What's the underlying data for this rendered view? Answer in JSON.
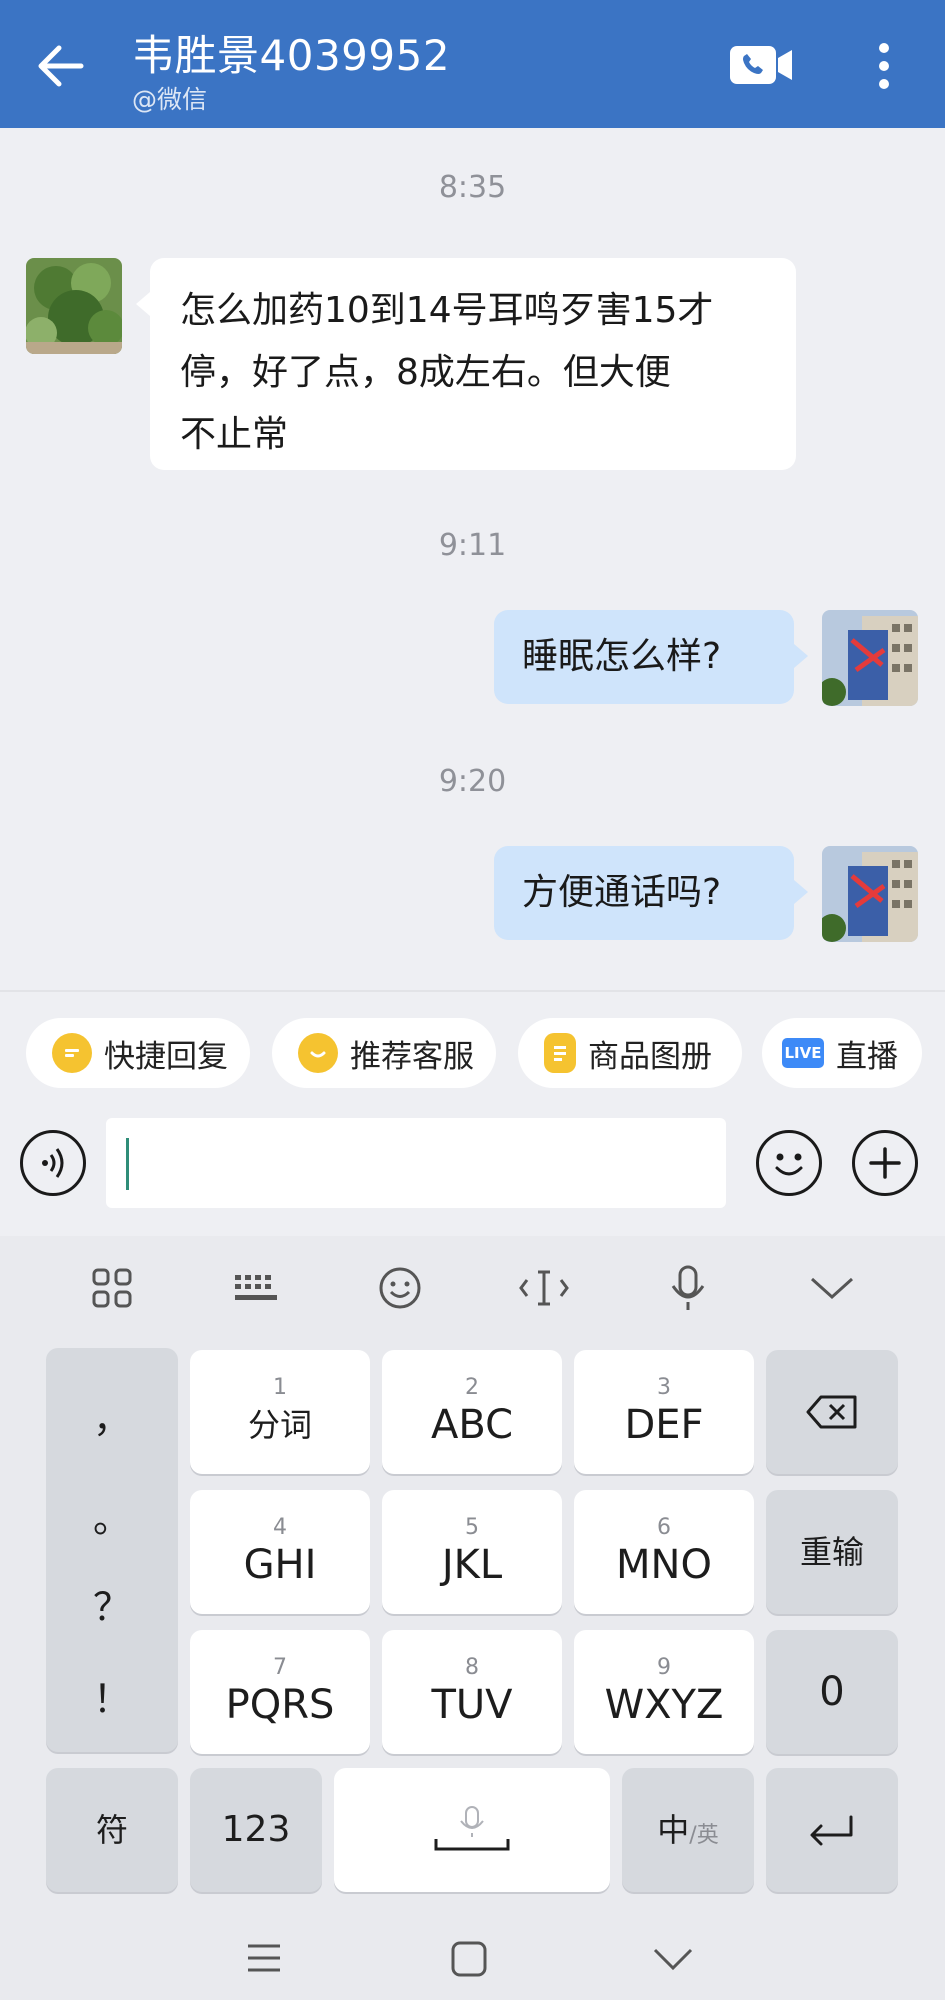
{
  "header": {
    "title": "韦胜景4039952",
    "subtitle": "@微信",
    "back_icon": "arrow-left-icon",
    "call_icon": "video-call-icon",
    "more_icon": "more-vertical-icon",
    "bg_color": "#3b74c4"
  },
  "messages": [
    {
      "time": "8:35",
      "from": "contact",
      "lines": [
        "怎么加药10到14号耳鸣歹害15才",
        "停，好了点，8成左右。但大便",
        "不止常"
      ]
    },
    {
      "time": "9:11",
      "from": "me",
      "lines": [
        "睡眠怎么样?"
      ]
    },
    {
      "time": "9:20",
      "from": "me",
      "lines": [
        "方便通话吗?"
      ]
    }
  ],
  "quick_actions": [
    {
      "label": "快捷回复",
      "icon": "quick-reply-icon"
    },
    {
      "label": "推荐客服",
      "icon": "recommend-service-icon"
    },
    {
      "label": "商品图册",
      "icon": "product-album-icon"
    },
    {
      "label": "直播",
      "icon": "live-icon",
      "badge": "LIVE"
    }
  ],
  "input": {
    "value": "",
    "placeholder": ""
  },
  "keyboard": {
    "toolbar": [
      "apps-grid-icon",
      "keyboard-icon",
      "emoji-icon",
      "cursor-icon",
      "microphone-icon",
      "collapse-icon"
    ],
    "punctuation": [
      "，",
      "。",
      "？",
      "！"
    ],
    "keys": [
      {
        "num": "1",
        "label": "分词"
      },
      {
        "num": "2",
        "label": "ABC"
      },
      {
        "num": "3",
        "label": "DEF"
      },
      {
        "num": "4",
        "label": "GHI"
      },
      {
        "num": "5",
        "label": "JKL"
      },
      {
        "num": "6",
        "label": "MNO"
      },
      {
        "num": "7",
        "label": "PQRS"
      },
      {
        "num": "8",
        "label": "TUV"
      },
      {
        "num": "9",
        "label": "WXYZ"
      }
    ],
    "reinput": "重输",
    "zero": "0",
    "symbols": "符",
    "numbers": "123",
    "lang_main": "中",
    "lang_alt": "/英"
  },
  "nav": [
    "menu-icon",
    "home-icon",
    "back-chevron-icon"
  ]
}
